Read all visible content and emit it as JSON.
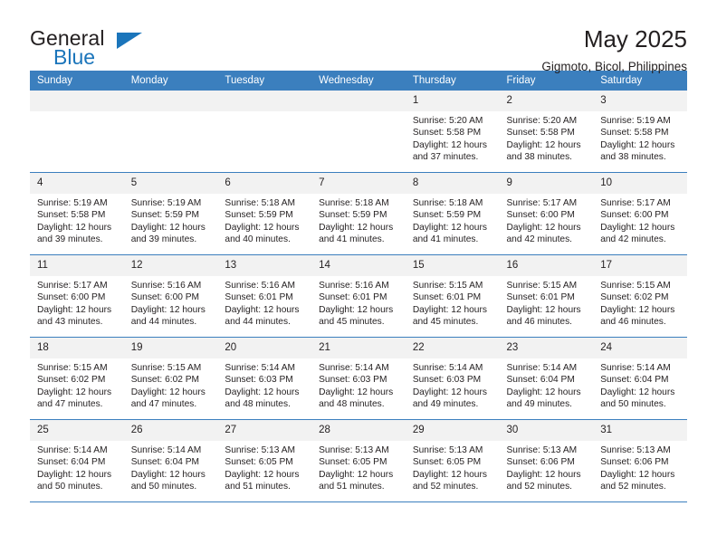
{
  "brand": {
    "name_part1": "General",
    "name_part2": "Blue",
    "triangle_color": "#1b75bb"
  },
  "header": {
    "title": "May 2025",
    "location": "Gigmoto, Bicol, Philippines"
  },
  "theme": {
    "header_blue": "#3b7fbe",
    "daynum_band": "#f2f2f2",
    "text": "#231f20"
  },
  "weekdays": [
    "Sunday",
    "Monday",
    "Tuesday",
    "Wednesday",
    "Thursday",
    "Friday",
    "Saturday"
  ],
  "weeks": [
    [
      {
        "day": "",
        "empty": true
      },
      {
        "day": "",
        "empty": true
      },
      {
        "day": "",
        "empty": true
      },
      {
        "day": "",
        "empty": true
      },
      {
        "day": "1",
        "sunrise": "Sunrise: 5:20 AM",
        "sunset": "Sunset: 5:58 PM",
        "daylight1": "Daylight: 12 hours",
        "daylight2": "and 37 minutes."
      },
      {
        "day": "2",
        "sunrise": "Sunrise: 5:20 AM",
        "sunset": "Sunset: 5:58 PM",
        "daylight1": "Daylight: 12 hours",
        "daylight2": "and 38 minutes."
      },
      {
        "day": "3",
        "sunrise": "Sunrise: 5:19 AM",
        "sunset": "Sunset: 5:58 PM",
        "daylight1": "Daylight: 12 hours",
        "daylight2": "and 38 minutes."
      }
    ],
    [
      {
        "day": "4",
        "sunrise": "Sunrise: 5:19 AM",
        "sunset": "Sunset: 5:58 PM",
        "daylight1": "Daylight: 12 hours",
        "daylight2": "and 39 minutes."
      },
      {
        "day": "5",
        "sunrise": "Sunrise: 5:19 AM",
        "sunset": "Sunset: 5:59 PM",
        "daylight1": "Daylight: 12 hours",
        "daylight2": "and 39 minutes."
      },
      {
        "day": "6",
        "sunrise": "Sunrise: 5:18 AM",
        "sunset": "Sunset: 5:59 PM",
        "daylight1": "Daylight: 12 hours",
        "daylight2": "and 40 minutes."
      },
      {
        "day": "7",
        "sunrise": "Sunrise: 5:18 AM",
        "sunset": "Sunset: 5:59 PM",
        "daylight1": "Daylight: 12 hours",
        "daylight2": "and 41 minutes."
      },
      {
        "day": "8",
        "sunrise": "Sunrise: 5:18 AM",
        "sunset": "Sunset: 5:59 PM",
        "daylight1": "Daylight: 12 hours",
        "daylight2": "and 41 minutes."
      },
      {
        "day": "9",
        "sunrise": "Sunrise: 5:17 AM",
        "sunset": "Sunset: 6:00 PM",
        "daylight1": "Daylight: 12 hours",
        "daylight2": "and 42 minutes."
      },
      {
        "day": "10",
        "sunrise": "Sunrise: 5:17 AM",
        "sunset": "Sunset: 6:00 PM",
        "daylight1": "Daylight: 12 hours",
        "daylight2": "and 42 minutes."
      }
    ],
    [
      {
        "day": "11",
        "sunrise": "Sunrise: 5:17 AM",
        "sunset": "Sunset: 6:00 PM",
        "daylight1": "Daylight: 12 hours",
        "daylight2": "and 43 minutes."
      },
      {
        "day": "12",
        "sunrise": "Sunrise: 5:16 AM",
        "sunset": "Sunset: 6:00 PM",
        "daylight1": "Daylight: 12 hours",
        "daylight2": "and 44 minutes."
      },
      {
        "day": "13",
        "sunrise": "Sunrise: 5:16 AM",
        "sunset": "Sunset: 6:01 PM",
        "daylight1": "Daylight: 12 hours",
        "daylight2": "and 44 minutes."
      },
      {
        "day": "14",
        "sunrise": "Sunrise: 5:16 AM",
        "sunset": "Sunset: 6:01 PM",
        "daylight1": "Daylight: 12 hours",
        "daylight2": "and 45 minutes."
      },
      {
        "day": "15",
        "sunrise": "Sunrise: 5:15 AM",
        "sunset": "Sunset: 6:01 PM",
        "daylight1": "Daylight: 12 hours",
        "daylight2": "and 45 minutes."
      },
      {
        "day": "16",
        "sunrise": "Sunrise: 5:15 AM",
        "sunset": "Sunset: 6:01 PM",
        "daylight1": "Daylight: 12 hours",
        "daylight2": "and 46 minutes."
      },
      {
        "day": "17",
        "sunrise": "Sunrise: 5:15 AM",
        "sunset": "Sunset: 6:02 PM",
        "daylight1": "Daylight: 12 hours",
        "daylight2": "and 46 minutes."
      }
    ],
    [
      {
        "day": "18",
        "sunrise": "Sunrise: 5:15 AM",
        "sunset": "Sunset: 6:02 PM",
        "daylight1": "Daylight: 12 hours",
        "daylight2": "and 47 minutes."
      },
      {
        "day": "19",
        "sunrise": "Sunrise: 5:15 AM",
        "sunset": "Sunset: 6:02 PM",
        "daylight1": "Daylight: 12 hours",
        "daylight2": "and 47 minutes."
      },
      {
        "day": "20",
        "sunrise": "Sunrise: 5:14 AM",
        "sunset": "Sunset: 6:03 PM",
        "daylight1": "Daylight: 12 hours",
        "daylight2": "and 48 minutes."
      },
      {
        "day": "21",
        "sunrise": "Sunrise: 5:14 AM",
        "sunset": "Sunset: 6:03 PM",
        "daylight1": "Daylight: 12 hours",
        "daylight2": "and 48 minutes."
      },
      {
        "day": "22",
        "sunrise": "Sunrise: 5:14 AM",
        "sunset": "Sunset: 6:03 PM",
        "daylight1": "Daylight: 12 hours",
        "daylight2": "and 49 minutes."
      },
      {
        "day": "23",
        "sunrise": "Sunrise: 5:14 AM",
        "sunset": "Sunset: 6:04 PM",
        "daylight1": "Daylight: 12 hours",
        "daylight2": "and 49 minutes."
      },
      {
        "day": "24",
        "sunrise": "Sunrise: 5:14 AM",
        "sunset": "Sunset: 6:04 PM",
        "daylight1": "Daylight: 12 hours",
        "daylight2": "and 50 minutes."
      }
    ],
    [
      {
        "day": "25",
        "sunrise": "Sunrise: 5:14 AM",
        "sunset": "Sunset: 6:04 PM",
        "daylight1": "Daylight: 12 hours",
        "daylight2": "and 50 minutes."
      },
      {
        "day": "26",
        "sunrise": "Sunrise: 5:14 AM",
        "sunset": "Sunset: 6:04 PM",
        "daylight1": "Daylight: 12 hours",
        "daylight2": "and 50 minutes."
      },
      {
        "day": "27",
        "sunrise": "Sunrise: 5:13 AM",
        "sunset": "Sunset: 6:05 PM",
        "daylight1": "Daylight: 12 hours",
        "daylight2": "and 51 minutes."
      },
      {
        "day": "28",
        "sunrise": "Sunrise: 5:13 AM",
        "sunset": "Sunset: 6:05 PM",
        "daylight1": "Daylight: 12 hours",
        "daylight2": "and 51 minutes."
      },
      {
        "day": "29",
        "sunrise": "Sunrise: 5:13 AM",
        "sunset": "Sunset: 6:05 PM",
        "daylight1": "Daylight: 12 hours",
        "daylight2": "and 52 minutes."
      },
      {
        "day": "30",
        "sunrise": "Sunrise: 5:13 AM",
        "sunset": "Sunset: 6:06 PM",
        "daylight1": "Daylight: 12 hours",
        "daylight2": "and 52 minutes."
      },
      {
        "day": "31",
        "sunrise": "Sunrise: 5:13 AM",
        "sunset": "Sunset: 6:06 PM",
        "daylight1": "Daylight: 12 hours",
        "daylight2": "and 52 minutes."
      }
    ]
  ]
}
